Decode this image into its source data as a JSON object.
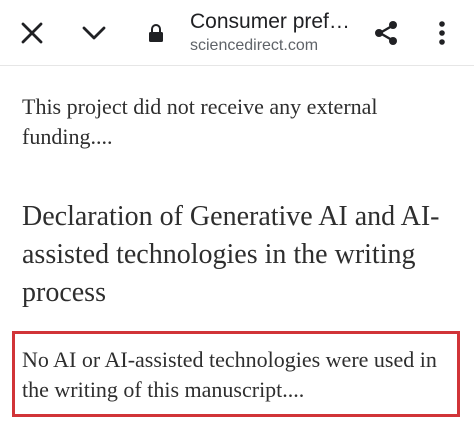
{
  "toolbar": {
    "title": "Consumer pref…",
    "host": "sciencedirect.com",
    "icon_color": "#202124",
    "icons": {
      "close": "close-icon",
      "collapse": "chevron-down-icon",
      "secure": "lock-icon",
      "share": "share-icon",
      "menu": "more-vert-icon"
    }
  },
  "article": {
    "funding_text": "This project did not receive any external funding....",
    "section_heading": "Declaration of Generative AI and AI-assisted technologies in the writing process",
    "declaration_text": "No AI or AI-assisted technologies were used in the writing of this manuscript...."
  },
  "highlight": {
    "border_color": "#d13438"
  }
}
